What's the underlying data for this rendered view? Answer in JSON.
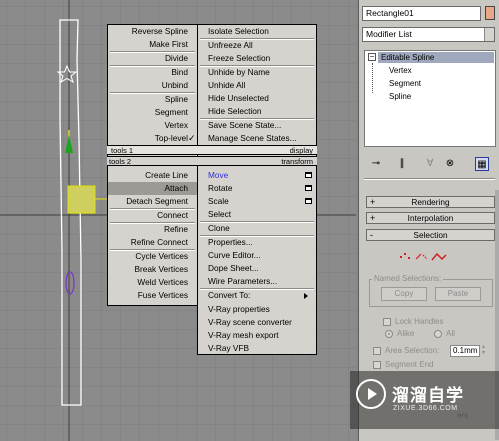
{
  "quad_left": {
    "tools1": [
      {
        "label": "Reverse Spline"
      },
      {
        "label": "Make First"
      },
      {
        "label": "Divide"
      },
      {
        "label": "Bind"
      },
      {
        "label": "Unbind"
      },
      {
        "label": "Spline"
      },
      {
        "label": "Segment"
      },
      {
        "label": "Vertex"
      },
      {
        "label": "Top-level",
        "checked": true
      }
    ],
    "header_tools1": "tools 1",
    "header_tools2": "tools 2",
    "tools2": [
      {
        "label": "Create Line"
      },
      {
        "label": "Attach",
        "highlighted": true
      },
      {
        "label": "Detach Segment"
      },
      {
        "label": "Connect"
      },
      {
        "label": "Refine"
      },
      {
        "label": "Refine Connect"
      },
      {
        "label": "Cycle Vertices"
      },
      {
        "label": "Break Vertices"
      },
      {
        "label": "Weld Vertices"
      },
      {
        "label": "Fuse Vertices"
      }
    ]
  },
  "quad_right": {
    "display": [
      {
        "label": "Isolate Selection"
      },
      {
        "label": "Unfreeze All"
      },
      {
        "label": "Freeze Selection"
      },
      {
        "label": "Unhide by Name"
      },
      {
        "label": "Unhide All"
      },
      {
        "label": "Hide Unselected"
      },
      {
        "label": "Hide Selection"
      },
      {
        "label": "Save Scene State..."
      },
      {
        "label": "Manage Scene States..."
      }
    ],
    "header_display": "display",
    "header_transform": "transform",
    "transform": [
      {
        "label": "Move",
        "blue": true,
        "icon": "dialog-icon"
      },
      {
        "label": "Rotate",
        "icon": "dialog-icon"
      },
      {
        "label": "Scale",
        "icon": "dialog-icon"
      },
      {
        "label": "Select"
      },
      {
        "label": "Clone"
      },
      {
        "label": "Properties..."
      },
      {
        "label": "Curve Editor..."
      },
      {
        "label": "Dope Sheet..."
      },
      {
        "label": "Wire Parameters..."
      },
      {
        "label": "Convert To:",
        "submenu": true
      },
      {
        "label": "V-Ray properties"
      },
      {
        "label": "V-Ray scene converter"
      },
      {
        "label": "V-Ray mesh export"
      },
      {
        "label": "V-Ray VFB"
      }
    ]
  },
  "panel": {
    "object_name": "Rectangle01",
    "object_color": "#e7a88a",
    "modifier_list": "Modifier List",
    "stack": {
      "root": "Editable Spline",
      "children": [
        "Vertex",
        "Segment",
        "Spline"
      ]
    },
    "rollouts": {
      "rendering": "Rendering",
      "interpolation": "Interpolation",
      "selection": "Selection"
    },
    "named_selections": {
      "label": "Named Selections:",
      "copy": "Copy",
      "paste": "Paste"
    },
    "lock_handles": {
      "label": "Lock Handles",
      "alike": "Alike",
      "all": "All"
    },
    "area_selection": {
      "label": "Area Selection:",
      "value": "0.1mm"
    },
    "segment_end": "Segment End",
    "select_by": "ers"
  },
  "watermark": {
    "brand": "溜溜自学",
    "url": "ZIXUE.3D66.COM"
  }
}
